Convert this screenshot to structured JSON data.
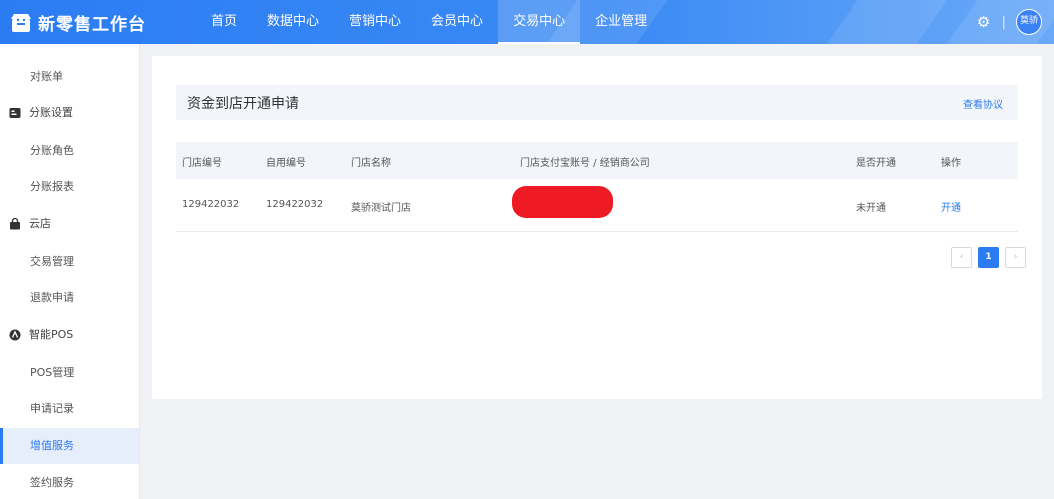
{
  "app": {
    "title": "新零售工作台"
  },
  "nav": {
    "items": [
      {
        "label": "首页"
      },
      {
        "label": "数据中心"
      },
      {
        "label": "营销中心"
      },
      {
        "label": "会员中心"
      },
      {
        "label": "交易中心",
        "active": true
      },
      {
        "label": "企业管理"
      }
    ]
  },
  "user": {
    "avatar_text": "莫骄",
    "settings_icon": "gear-icon"
  },
  "sidebar": {
    "items": [
      {
        "label": "对账单",
        "type": "sub"
      },
      {
        "label": "分账设置",
        "type": "group",
        "icon": "ledger-icon"
      },
      {
        "label": "分账角色",
        "type": "sub"
      },
      {
        "label": "分账报表",
        "type": "sub"
      },
      {
        "label": "云店",
        "type": "group",
        "icon": "bag-icon"
      },
      {
        "label": "交易管理",
        "type": "sub"
      },
      {
        "label": "退款申请",
        "type": "sub"
      },
      {
        "label": "智能POS",
        "type": "group",
        "icon": "pos-icon"
      },
      {
        "label": "POS管理",
        "type": "sub"
      },
      {
        "label": "申请记录",
        "type": "sub"
      },
      {
        "label": "增值服务",
        "type": "sub",
        "active": true
      },
      {
        "label": "签约服务",
        "type": "sub"
      }
    ]
  },
  "main": {
    "title": "资金到店开通申请",
    "agreement_link": "查看协议",
    "table": {
      "headers": [
        "门店编号",
        "自用编号",
        "门店名称",
        "门店支付宝账号 / 经销商公司",
        "是否开通",
        "操作"
      ],
      "rows": [
        {
          "store_no": "129422032",
          "own_no": "129422032",
          "store_name": "莫骄测试门店",
          "account": "",
          "opened": "未开通",
          "action": "开通"
        }
      ]
    },
    "pagination": {
      "current": "1",
      "prev_icon": "chevron-left-icon",
      "next_icon": "chevron-right-icon"
    }
  },
  "colors": {
    "primary": "#2b7cf3",
    "redaction": "#ee1b24",
    "header_bg": "#f2f5fa"
  }
}
